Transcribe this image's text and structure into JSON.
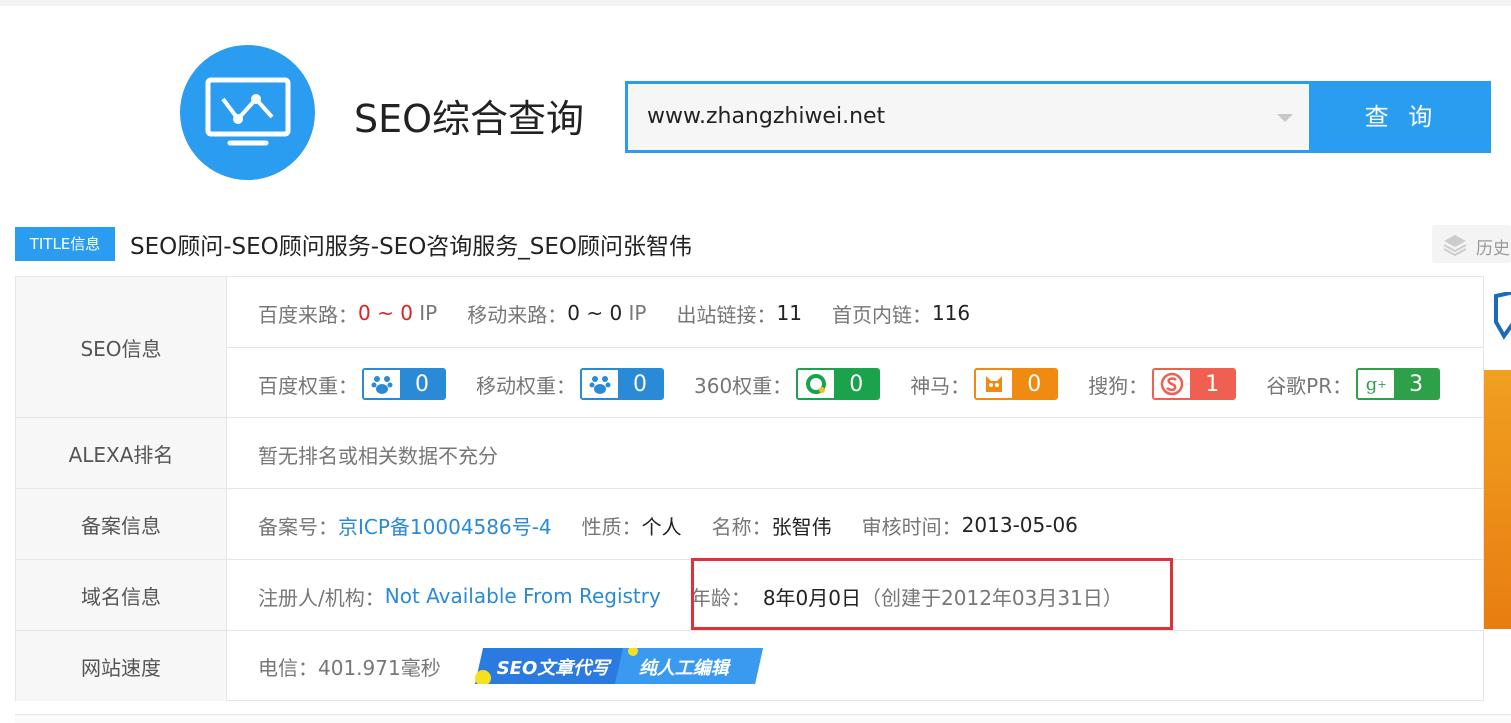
{
  "app": {
    "title": "SEO综合查询"
  },
  "search": {
    "value": "www.zhangzhiwei.net",
    "button": "查 询"
  },
  "title_info": {
    "badge": "TITLE信息",
    "text": "SEO顾问-SEO顾问服务-SEO咨询服务_SEO顾问张智伟"
  },
  "history": {
    "label": "历史"
  },
  "seo": {
    "heading": "SEO信息",
    "baidu_traffic_label": "百度来路：",
    "baidu_traffic_value": "0 ~ 0",
    "baidu_traffic_unit": "IP",
    "mobile_traffic_label": "移动来路：",
    "mobile_traffic_value": "0 ~ 0",
    "mobile_traffic_unit": "IP",
    "outbound_label": "出站链接：",
    "outbound_value": "11",
    "internal_label": "首页内链：",
    "internal_value": "116",
    "weights": [
      {
        "label": "百度权重：",
        "value": "0",
        "color": "#2a8ad6",
        "icon": "baidu-paw-icon"
      },
      {
        "label": "移动权重：",
        "value": "0",
        "color": "#2a8ad6",
        "icon": "baidu-mobile-paw-icon"
      },
      {
        "label": "360权重：",
        "value": "0",
        "color": "#1aa34a",
        "icon": "360-icon"
      },
      {
        "label": "神马：",
        "value": "0",
        "color": "#f08a10",
        "icon": "shenma-icon"
      },
      {
        "label": "搜狗：",
        "value": "1",
        "color": "#f06050",
        "icon": "sogou-icon"
      },
      {
        "label": "谷歌PR：",
        "value": "3",
        "color": "#2ea04a",
        "icon": "google-plus-icon"
      }
    ]
  },
  "alexa": {
    "heading": "ALEXA排名",
    "text": "暂无排名或相关数据不充分"
  },
  "icp": {
    "heading": "备案信息",
    "number_label": "备案号：",
    "number_value": "京ICP备10004586号-4",
    "type_label": "性质：",
    "type_value": "个人",
    "name_label": "名称：",
    "name_value": "张智伟",
    "audit_label": "审核时间：",
    "audit_value": "2013-05-06"
  },
  "domain": {
    "heading": "域名信息",
    "registrant_label": "注册人/机构：",
    "registrant_value": "Not Available From Registry",
    "age_label": "年龄：",
    "age_value": "8年0月0日",
    "created": "（创建于2012年03月31日）"
  },
  "speed": {
    "heading": "网站速度",
    "telecom_label": "电信：",
    "telecom_value": "401.971毫秒",
    "ad_left": "SEO文章代写",
    "ad_right": "纯人工编辑"
  }
}
